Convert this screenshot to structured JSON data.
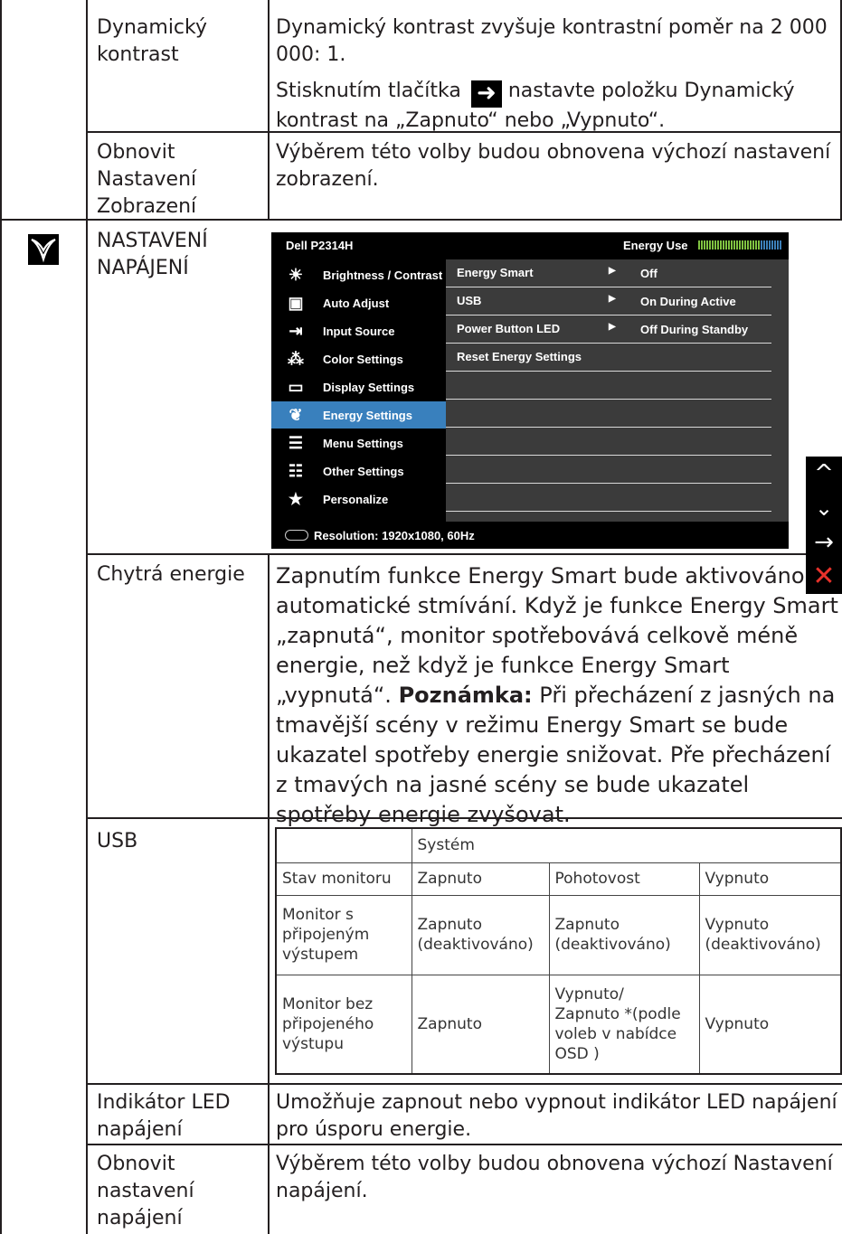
{
  "rows": {
    "dynamic_contrast": {
      "label": "Dynamický kontrast",
      "text1": "Dynamický kontrast zvyšuje kontrastní poměr na 2 000 000: 1.",
      "text2_pre": "Stisknutím tlačítka",
      "text2_post": " nastavte položku Dynamický kontrast na „Zapnuto“ nebo „Vypnuto“."
    },
    "reset_display": {
      "label": "Obnovit Nastavení Zobrazení",
      "text": "Výběrem této volby budou obnovena výchozí nastavení zobrazení."
    },
    "power_settings": {
      "label": "NASTAVENÍ NAPÁJENÍ"
    },
    "smart_energy": {
      "label": "Chytrá energie",
      "text": "Zapnutím funkce Energy Smart bude aktivováno automatické stmívání. Když je funkce Energy Smart „zapnutá“, monitor spotřebovává celkově méně energie, než když je funkce Energy Smart „vypnutá“.",
      "note_label": "Poznámka:",
      "note_text": " Při přecházení z jasných na tmavější scény v režimu Energy Smart se bude ukazatel spotřeby energie snižovat. Pře přecházení z tmavých na jasné scény se bude ukazatel spotřeby energie zvyšovat."
    },
    "usb": {
      "label": "USB"
    },
    "led": {
      "label": "Indikátor LED napájení",
      "text": "Umožňuje zapnout nebo vypnout indikátor LED napájení pro úsporu energie."
    },
    "reset_power": {
      "label": "Obnovit nastavení napájení",
      "text": "Výběrem této volby budou obnovena výchozí Nastavení napájení."
    }
  },
  "osd": {
    "title": "Dell P2314H",
    "energy_label": "Energy Use",
    "energy_level": 0.75,
    "menu": [
      {
        "label": "Brightness / Contrast",
        "icon": "sun-icon"
      },
      {
        "label": "Auto Adjust",
        "icon": "auto-adjust-icon"
      },
      {
        "label": "Input Source",
        "icon": "input-source-icon"
      },
      {
        "label": "Color Settings",
        "icon": "color-dots-icon"
      },
      {
        "label": "Display Settings",
        "icon": "display-icon"
      },
      {
        "label": "Energy Settings",
        "icon": "leaf-icon",
        "active": true
      },
      {
        "label": "Menu Settings",
        "icon": "menu-icon"
      },
      {
        "label": "Other Settings",
        "icon": "sliders-icon"
      },
      {
        "label": "Personalize",
        "icon": "star-icon"
      }
    ],
    "panel": [
      {
        "key": "Energy Smart",
        "value": "Off"
      },
      {
        "key": "USB",
        "value": "On During Active"
      },
      {
        "key": "Power Button LED",
        "value": "Off During Standby"
      },
      {
        "key": "Reset Energy Settings",
        "value": ""
      }
    ],
    "resolution": "Resolution:  1920x1080, 60Hz"
  },
  "usb_table": {
    "header": "Systém",
    "columns": [
      "Stav monitoru",
      "Zapnuto",
      "Pohotovost",
      "Vypnuto"
    ],
    "rows": [
      [
        "Monitor s připojeným výstupem",
        "Zapnuto (deaktivováno)",
        "Zapnuto (deaktivováno)",
        "Vypnuto (deaktivováno)"
      ],
      [
        "Monitor bez připojeného výstupu",
        "Zapnuto",
        "Vypnuto/ Zapnuto *(podle voleb v nabídce OSD )",
        "Vypnuto"
      ]
    ]
  }
}
